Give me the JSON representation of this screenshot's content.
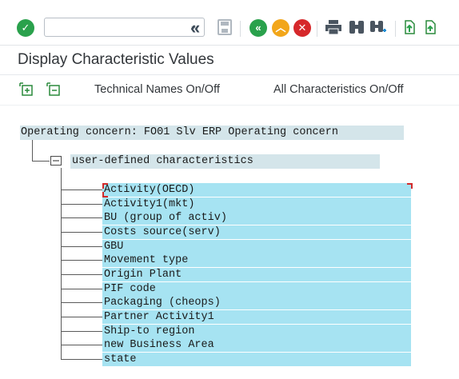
{
  "toolbar": {
    "command_field": {
      "value": "",
      "placeholder": ""
    },
    "icons": [
      "enter-icon",
      "back-double-icon",
      "save-icon",
      "back-icon",
      "exit-icon",
      "cancel-icon",
      "print-icon",
      "find-icon",
      "find-next-icon",
      "first-page-icon",
      "previous-page-icon"
    ]
  },
  "page": {
    "title": "Display Characteristic Values"
  },
  "app_toolbar": {
    "technical_names": "Technical Names On/Off",
    "all_characteristics": "All Characteristics On/Off"
  },
  "tree": {
    "root": "Operating concern: FO01 Slv ERP Operating concern",
    "group": "user-defined characteristics",
    "items": [
      "Activity(OECD)",
      "Activity1(mkt)",
      "BU (group of activ)",
      "Costs source(serv)",
      "GBU",
      "Movement type",
      "Origin Plant",
      "PIF code",
      "Packaging (cheops)",
      "Partner Activity1",
      "Ship-to region",
      "new Business Area",
      "state"
    ]
  }
}
